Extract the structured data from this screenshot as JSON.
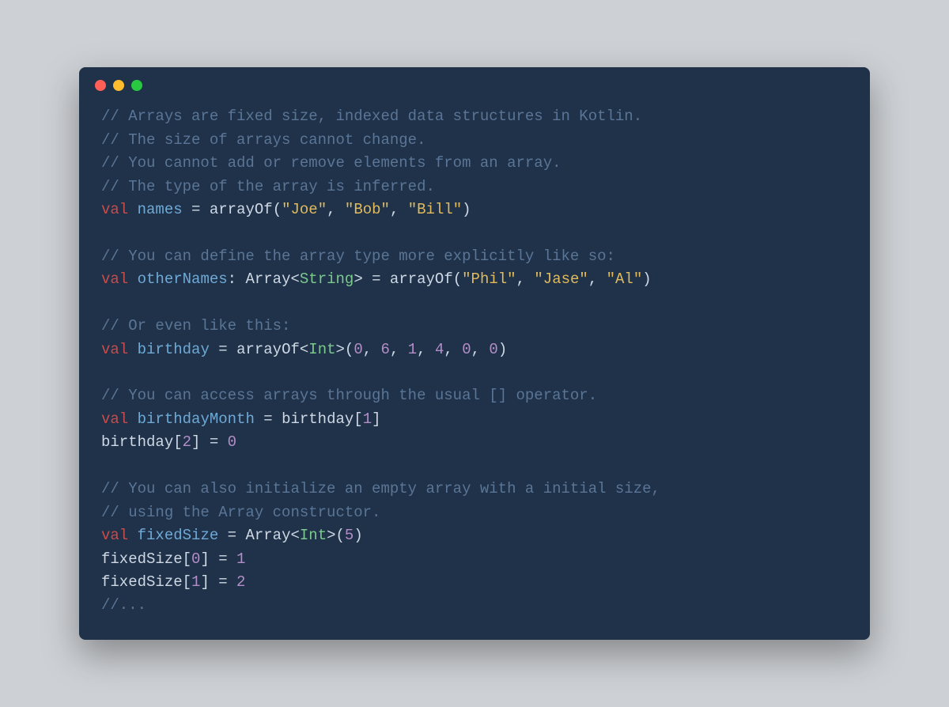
{
  "window": {
    "traffic_lights": [
      "red",
      "yellow",
      "green"
    ]
  },
  "code": {
    "tokens": [
      [
        [
          "c",
          "// Arrays are fixed size, indexed data structures in Kotlin."
        ]
      ],
      [
        [
          "c",
          "// The size of arrays cannot change."
        ]
      ],
      [
        [
          "c",
          "// You cannot add or remove elements from an array."
        ]
      ],
      [
        [
          "c",
          "// The type of the array is inferred."
        ]
      ],
      [
        [
          "kw",
          "val"
        ],
        [
          "op",
          " "
        ],
        [
          "id",
          "names"
        ],
        [
          "op",
          " = "
        ],
        [
          "fn",
          "arrayOf"
        ],
        [
          "op",
          "("
        ],
        [
          "st",
          "\"Joe\""
        ],
        [
          "op",
          ", "
        ],
        [
          "st",
          "\"Bob\""
        ],
        [
          "op",
          ", "
        ],
        [
          "st",
          "\"Bill\""
        ],
        [
          "op",
          ")"
        ]
      ],
      [],
      [
        [
          "c",
          "// You can define the array type more explicitly like so:"
        ]
      ],
      [
        [
          "kw",
          "val"
        ],
        [
          "op",
          " "
        ],
        [
          "id",
          "otherNames"
        ],
        [
          "op",
          ": "
        ],
        [
          "ty",
          "Array"
        ],
        [
          "op",
          "<"
        ],
        [
          "tp",
          "String"
        ],
        [
          "op",
          "> = "
        ],
        [
          "fn",
          "arrayOf"
        ],
        [
          "op",
          "("
        ],
        [
          "st",
          "\"Phil\""
        ],
        [
          "op",
          ", "
        ],
        [
          "st",
          "\"Jase\""
        ],
        [
          "op",
          ", "
        ],
        [
          "st",
          "\"Al\""
        ],
        [
          "op",
          ")"
        ]
      ],
      [],
      [
        [
          "c",
          "// Or even like this:"
        ]
      ],
      [
        [
          "kw",
          "val"
        ],
        [
          "op",
          " "
        ],
        [
          "id",
          "birthday"
        ],
        [
          "op",
          " = "
        ],
        [
          "fn",
          "arrayOf"
        ],
        [
          "op",
          "<"
        ],
        [
          "tp",
          "Int"
        ],
        [
          "op",
          ">("
        ],
        [
          "nu",
          "0"
        ],
        [
          "op",
          ", "
        ],
        [
          "nu",
          "6"
        ],
        [
          "op",
          ", "
        ],
        [
          "nu",
          "1"
        ],
        [
          "op",
          ", "
        ],
        [
          "nu",
          "4"
        ],
        [
          "op",
          ", "
        ],
        [
          "nu",
          "0"
        ],
        [
          "op",
          ", "
        ],
        [
          "nu",
          "0"
        ],
        [
          "op",
          ")"
        ]
      ],
      [],
      [
        [
          "c",
          "// You can access arrays through the usual [] operator."
        ]
      ],
      [
        [
          "kw",
          "val"
        ],
        [
          "op",
          " "
        ],
        [
          "id",
          "birthdayMonth"
        ],
        [
          "op",
          " = "
        ],
        [
          "fn",
          "birthday"
        ],
        [
          "op",
          "["
        ],
        [
          "nu",
          "1"
        ],
        [
          "op",
          "]"
        ]
      ],
      [
        [
          "fn",
          "birthday"
        ],
        [
          "op",
          "["
        ],
        [
          "nu",
          "2"
        ],
        [
          "op",
          "] = "
        ],
        [
          "nu",
          "0"
        ]
      ],
      [],
      [
        [
          "c",
          "// You can also initialize an empty array with a initial size,"
        ]
      ],
      [
        [
          "c",
          "// using the Array constructor."
        ]
      ],
      [
        [
          "kw",
          "val"
        ],
        [
          "op",
          " "
        ],
        [
          "id",
          "fixedSize"
        ],
        [
          "op",
          " = "
        ],
        [
          "ty",
          "Array"
        ],
        [
          "op",
          "<"
        ],
        [
          "tp",
          "Int"
        ],
        [
          "op",
          ">("
        ],
        [
          "nu",
          "5"
        ],
        [
          "op",
          ")"
        ]
      ],
      [
        [
          "fn",
          "fixedSize"
        ],
        [
          "op",
          "["
        ],
        [
          "nu",
          "0"
        ],
        [
          "op",
          "] = "
        ],
        [
          "nu",
          "1"
        ]
      ],
      [
        [
          "fn",
          "fixedSize"
        ],
        [
          "op",
          "["
        ],
        [
          "nu",
          "1"
        ],
        [
          "op",
          "] = "
        ],
        [
          "nu",
          "2"
        ]
      ],
      [
        [
          "c",
          "//..."
        ]
      ]
    ]
  }
}
